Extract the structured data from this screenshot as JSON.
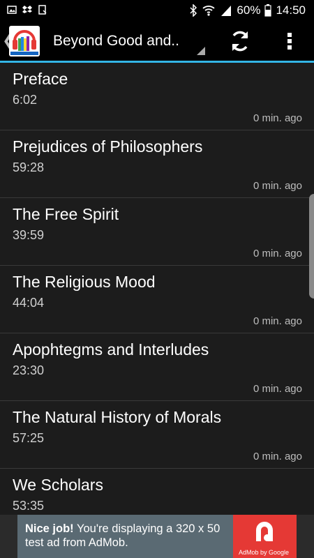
{
  "status_bar": {
    "battery_percent": "60%",
    "time": "14:50"
  },
  "action_bar": {
    "title": "Beyond Good and..",
    "back_glyph": "❮"
  },
  "chapters": [
    {
      "title": "Preface",
      "duration": "6:02",
      "ago": "0 min. ago"
    },
    {
      "title": "Prejudices of Philosophers",
      "duration": "59:28",
      "ago": "0 min. ago"
    },
    {
      "title": "The Free Spirit",
      "duration": "39:59",
      "ago": "0 min. ago"
    },
    {
      "title": "The Religious Mood",
      "duration": "44:04",
      "ago": "0 min. ago"
    },
    {
      "title": "Apophtegms and Interludes",
      "duration": "23:30",
      "ago": "0 min. ago"
    },
    {
      "title": "The Natural History of Morals",
      "duration": "57:25",
      "ago": "0 min. ago"
    },
    {
      "title": "We Scholars",
      "duration": "53:35",
      "ago": ""
    }
  ],
  "ad": {
    "headline": "Nice job!",
    "body": " You're displaying a 320 x 50 test ad from AdMob.",
    "badge": "AdMob by Google"
  },
  "colors": {
    "accent": "#33b5e5",
    "background": "#1c1c1c",
    "ad_background": "#5a6a73",
    "ad_logo": "#e53935"
  }
}
